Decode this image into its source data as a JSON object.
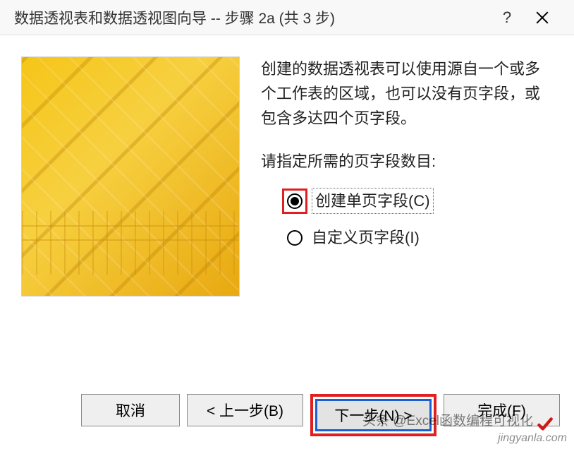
{
  "titlebar": {
    "title": "数据透视表和数据透视图向导 -- 步骤 2a (共 3 步)",
    "help": "?",
    "close": "×"
  },
  "content": {
    "description": "创建的数据透视表可以使用源自一个或多个工作表的区域，也可以没有页字段，或包含多达四个页字段。",
    "prompt": "请指定所需的页字段数目:",
    "radios": [
      {
        "label": "创建单页字段(C)",
        "selected": true
      },
      {
        "label": "自定义页字段(I)",
        "selected": false
      }
    ]
  },
  "buttons": {
    "cancel": "取消",
    "back": "< 上一步(B)",
    "next": "下一步(N) >",
    "finish": "完成(F)"
  },
  "watermark": {
    "line1": "头条 @Excel函数编程可视化",
    "line2": "jingyanla.com"
  }
}
